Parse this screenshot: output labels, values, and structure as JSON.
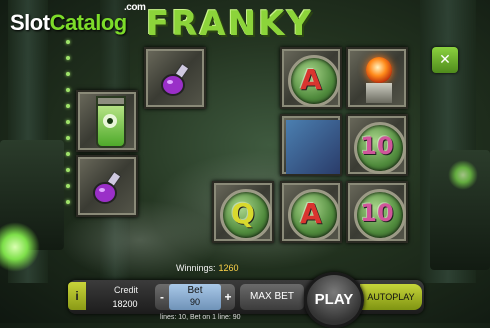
{
  "branding": {
    "logo_slot": "Slot",
    "logo_catalog": "Catalog",
    "logo_com": ".com",
    "game_title": "FRANKY"
  },
  "grid": {
    "cells": [
      {
        "symbol": "potion-flask"
      },
      {
        "symbol": "eye-jar"
      },
      {
        "symbol": "potion-flask"
      },
      {
        "symbol": "letter-a",
        "label": "A"
      },
      {
        "symbol": "tesla-orb"
      },
      {
        "symbol": "brain-machine"
      },
      {
        "symbol": "ten",
        "label": "10"
      },
      {
        "symbol": "letter-q",
        "label": "Q"
      },
      {
        "symbol": "letter-a",
        "label": "A"
      },
      {
        "symbol": "ten",
        "label": "10"
      }
    ]
  },
  "controls": {
    "mute_icon": "speaker-mute-icon",
    "mute_glyph": "✕",
    "info_label": "i",
    "winnings_label": "Winnings:",
    "winnings_value": "1260",
    "credit_label": "Credit",
    "credit_value": "18200",
    "bet_label": "Bet",
    "bet_value": "90",
    "bet_minus": "-",
    "bet_plus": "+",
    "maxbet_label": "MAX BET",
    "play_label": "PLAY",
    "autoplay_label": "AUTOPLAY",
    "lines_text": "lines: 10,   Bet on 1 line: 90"
  },
  "colors": {
    "accent_green": "#7ddc2a",
    "winnings_value": "#ffd44a",
    "autoplay": "#c6d43a"
  }
}
